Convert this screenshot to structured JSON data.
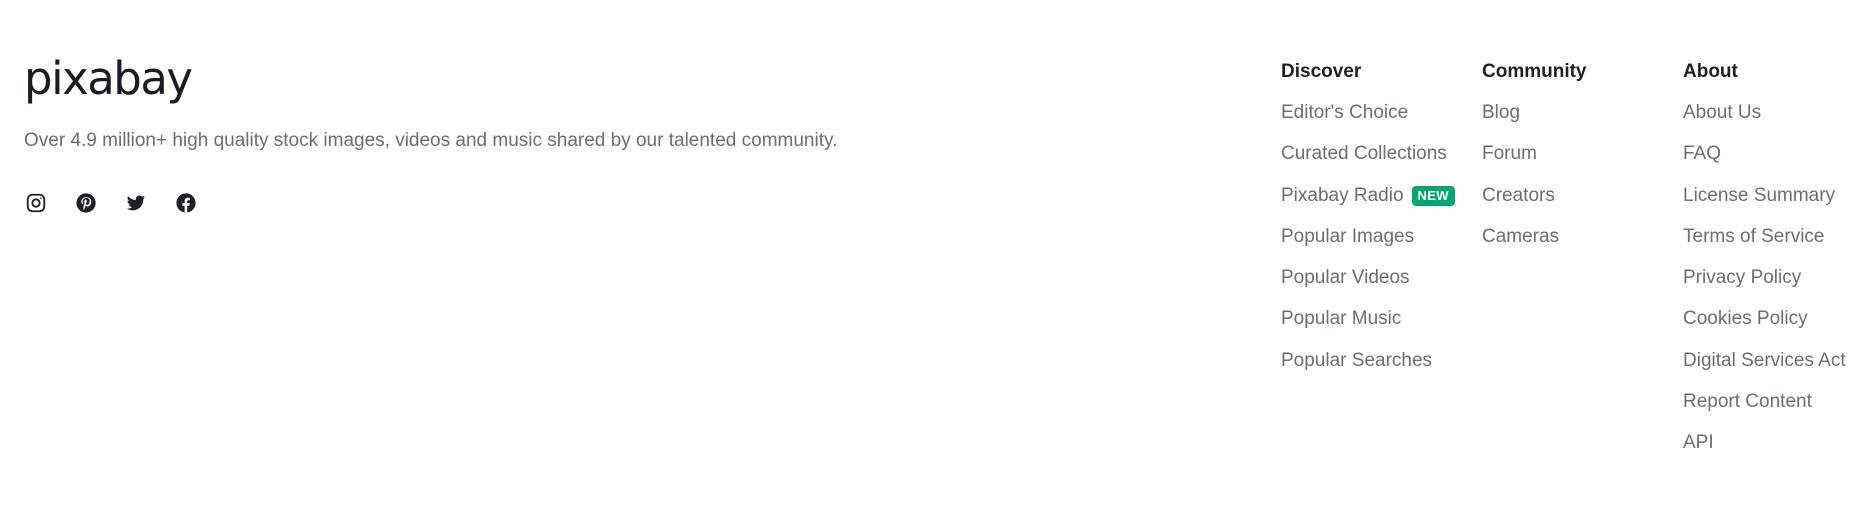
{
  "brand": {
    "logo_text": "pixabay",
    "tagline": "Over 4.9 million+ high quality stock images, videos and music shared by our talented community."
  },
  "socials": [
    {
      "icon": "instagram-icon"
    },
    {
      "icon": "pinterest-icon"
    },
    {
      "icon": "twitter-icon"
    },
    {
      "icon": "facebook-icon"
    }
  ],
  "columns": {
    "discover": {
      "title": "Discover",
      "items": [
        "Editor's Choice",
        "Curated Collections",
        "Pixabay Radio",
        "Popular Images",
        "Popular Videos",
        "Popular Music",
        "Popular Searches"
      ],
      "badge": "NEW"
    },
    "community": {
      "title": "Community",
      "items": [
        "Blog",
        "Forum",
        "Creators",
        "Cameras"
      ]
    },
    "about": {
      "title": "About",
      "items": [
        "About Us",
        "FAQ",
        "License Summary",
        "Terms of Service",
        "Privacy Policy",
        "Cookies Policy",
        "Digital Services Act",
        "Report Content",
        "API"
      ]
    }
  },
  "colors": {
    "text_dark": "#1f2128",
    "text_muted": "#6b6e78",
    "badge_green": "#05a56f"
  }
}
